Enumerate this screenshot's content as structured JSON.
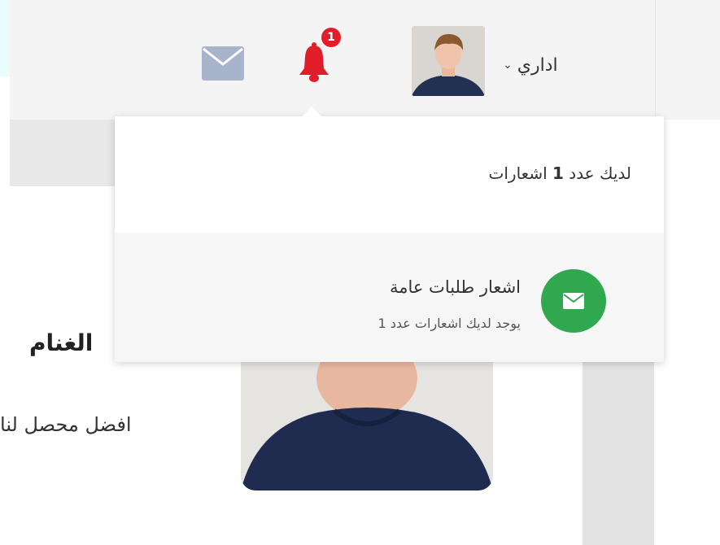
{
  "header": {
    "user_name": "اداري",
    "chevron_icon": "chevron-down-icon",
    "notification_count": "1",
    "icons": [
      "envelope-icon",
      "bell-icon",
      "user-avatar"
    ],
    "bell_color": "#e11d2a",
    "envelope_color": "#a8b4cc"
  },
  "notifications": {
    "header_prefix": "لديك عدد",
    "header_count": "1",
    "header_suffix": "اشعارات",
    "items": [
      {
        "title": "اشعار طلبات عامة",
        "subtitle": "يوجد لديك اشعارات عدد 1",
        "icon": "envelope-icon",
        "icon_color": "#2fa84f"
      }
    ]
  },
  "page": {
    "name_fragment": "الغنام",
    "desc_fragment": "افضل محصل لنا"
  }
}
